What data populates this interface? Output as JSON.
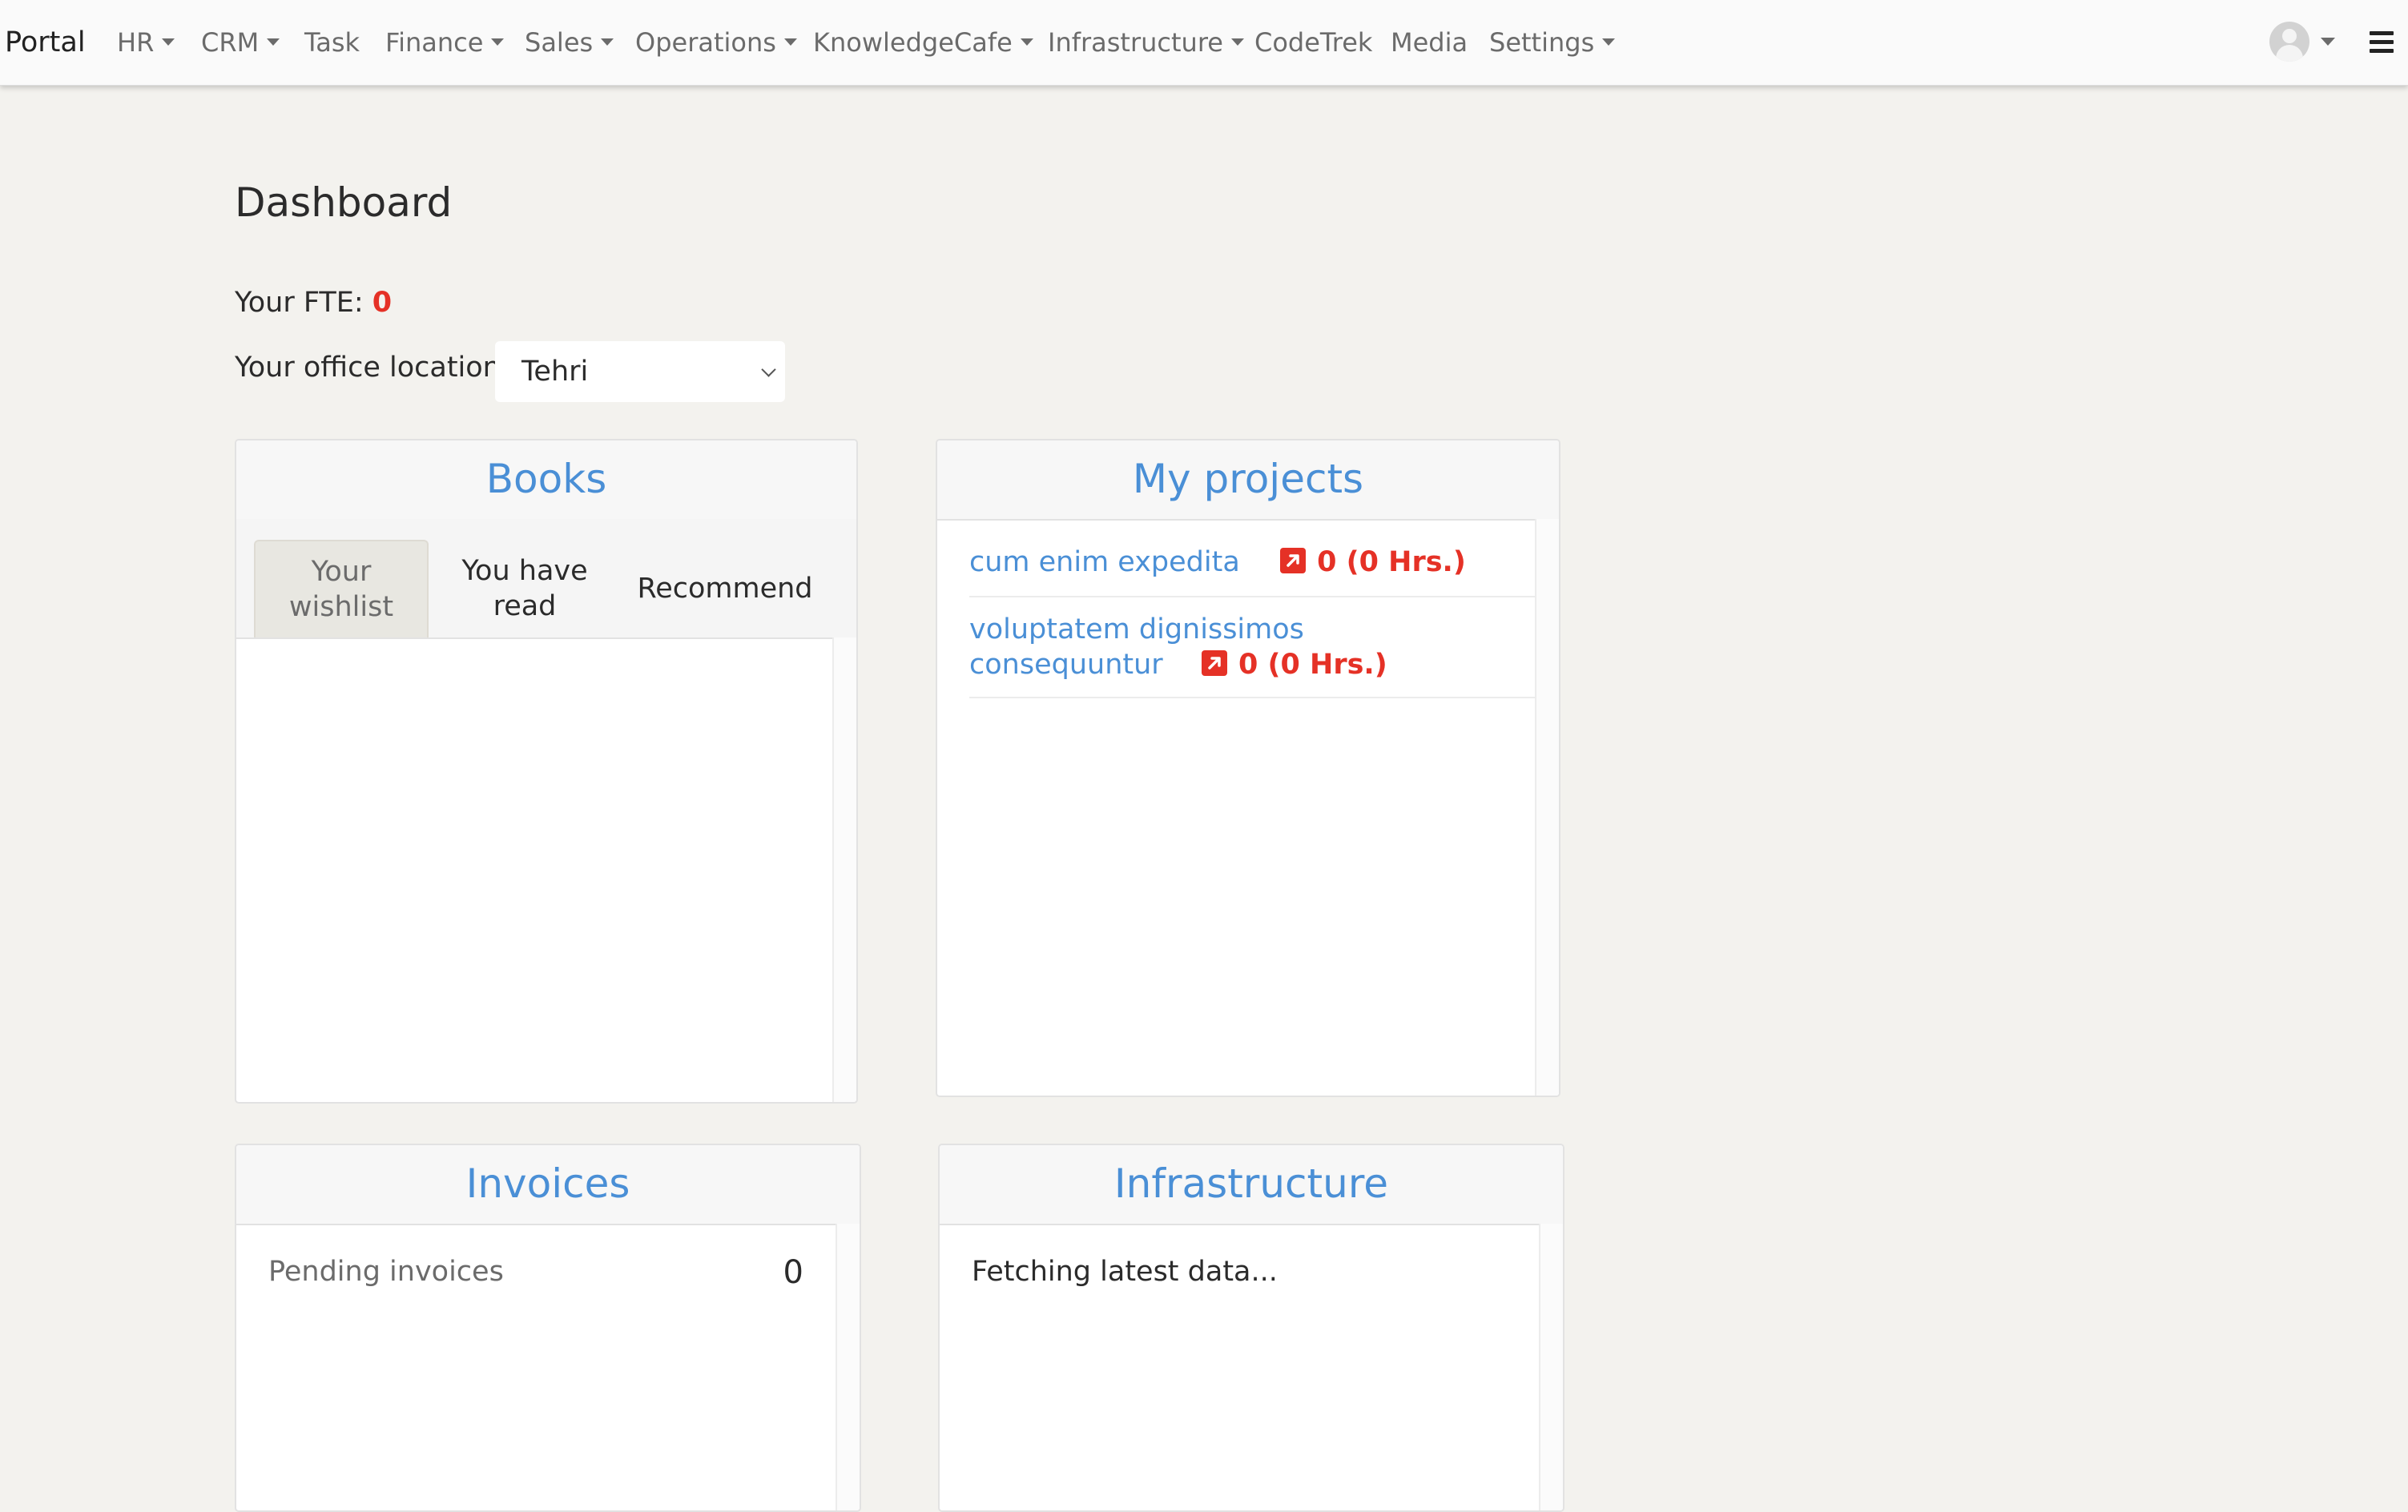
{
  "navbar": {
    "brand": "Portal",
    "items": [
      {
        "label": "HR",
        "dropdown": true
      },
      {
        "label": "CRM",
        "dropdown": true
      },
      {
        "label": "Task",
        "dropdown": false
      },
      {
        "label": "Finance",
        "dropdown": true
      },
      {
        "label": "Sales",
        "dropdown": true
      },
      {
        "label": "Operations",
        "dropdown": true
      },
      {
        "label": "KnowledgeCafe",
        "dropdown": true
      },
      {
        "label": "Infrastructure",
        "dropdown": true
      },
      {
        "label": "CodeTrek",
        "dropdown": false
      },
      {
        "label": "Media",
        "dropdown": false
      },
      {
        "label": "Settings",
        "dropdown": true
      }
    ],
    "icons": [
      "user-avatar-icon",
      "chevron-down-icon",
      "hamburger-menu-icon"
    ]
  },
  "page": {
    "title": "Dashboard",
    "fte_label": "Your FTE:",
    "fte_value": "0",
    "office_label": "Your office location",
    "office_value": "Tehri"
  },
  "books": {
    "title": "Books",
    "tabs": [
      {
        "line1": "Your",
        "line2": "wishlist",
        "active": true
      },
      {
        "line1": "You have",
        "line2": "read",
        "active": false
      },
      {
        "line1": "Recommend",
        "line2": "",
        "active": false
      }
    ]
  },
  "projects": {
    "title": "My projects",
    "items": [
      {
        "line1": "cum enim expedita",
        "line2": "",
        "hours": "0 (0 Hrs.)"
      },
      {
        "line1": "voluptatem dignissimos",
        "line2": "consequuntur",
        "hours": "0 (0 Hrs.)"
      }
    ]
  },
  "invoices": {
    "title": "Invoices",
    "pending_label": "Pending invoices",
    "pending_value": "0"
  },
  "infrastructure": {
    "title": "Infrastructure",
    "status": "Fetching latest data..."
  },
  "colors": {
    "background": "#f3f2ee",
    "link": "#4a8fd6",
    "danger": "#e53126",
    "navbar": "#fafafa"
  }
}
